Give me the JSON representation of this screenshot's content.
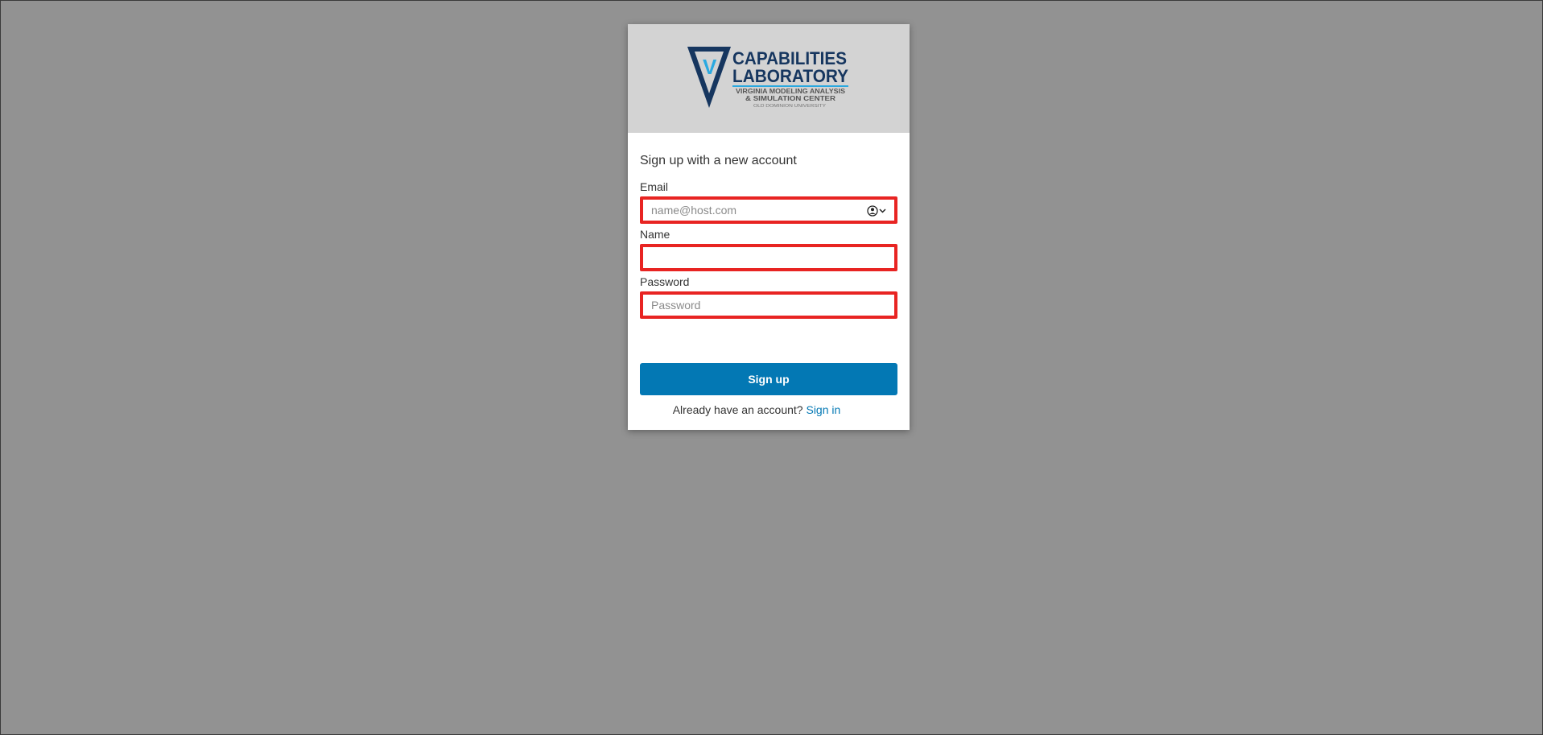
{
  "logo": {
    "line1": "CAPABILITIES",
    "line2": "LABORATORY",
    "line3": "VIRGINIA MODELING ANALYSIS",
    "line4": "& SIMULATION CENTER",
    "line5": "OLD DOMINION UNIVERSITY",
    "letter": "V",
    "colors": {
      "navy": "#16365f",
      "cyan": "#2aa9e0",
      "gray": "#555555"
    }
  },
  "form": {
    "heading": "Sign up with a new account",
    "email": {
      "label": "Email",
      "placeholder": "name@host.com",
      "value": ""
    },
    "name": {
      "label": "Name",
      "placeholder": "",
      "value": ""
    },
    "password": {
      "label": "Password",
      "placeholder": "Password",
      "value": ""
    },
    "submit_label": "Sign up",
    "signin_prompt": "Already have an account?",
    "signin_link": "Sign in"
  },
  "icons": {
    "autofill": "contact-autofill-icon"
  },
  "colors": {
    "background": "#929292",
    "card": "#ffffff",
    "logo_band": "#d3d3d3",
    "primary": "#0378b4",
    "highlight_border": "#e82422"
  }
}
